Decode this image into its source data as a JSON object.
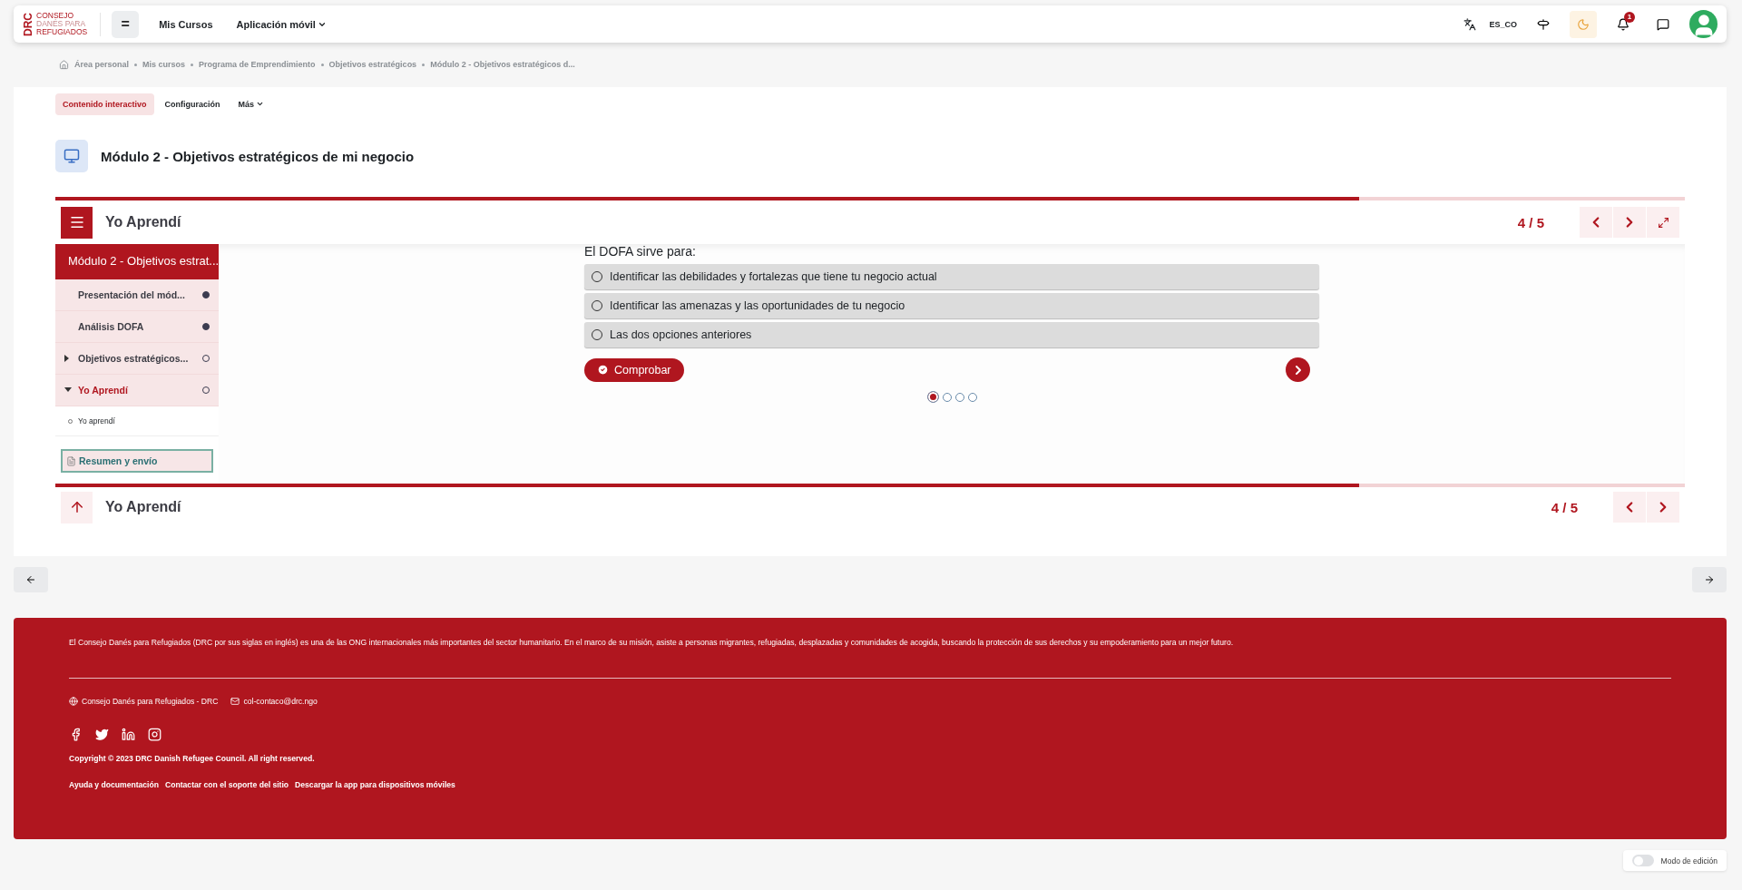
{
  "navbar": {
    "logo_mark": "DRC",
    "logo_lines": [
      "CONSEJO",
      "DANÉS PARA",
      "REFUGIADOS"
    ],
    "menu_button": "=",
    "links": [
      {
        "label": "Mis Cursos",
        "dropdown": false
      },
      {
        "label": "Aplicación móvil",
        "dropdown": true
      }
    ],
    "language": "ES_CO",
    "notifications": "1"
  },
  "breadcrumb": [
    "Área personal",
    "Mis cursos",
    "Programa de Emprendimiento",
    "Objetivos estratégicos",
    "Módulo 2 - Objetivos estratégicos d..."
  ],
  "tabs": [
    {
      "label": "Contenido interactivo",
      "selected": true,
      "dropdown": false
    },
    {
      "label": "Configuración",
      "selected": false,
      "dropdown": false
    },
    {
      "label": "Más",
      "selected": false,
      "dropdown": true
    }
  ],
  "page_title": "Módulo 2 - Objetivos estratégicos de mi negocio",
  "player": {
    "title": "Yo Aprendí",
    "progress": {
      "level": 0.8
    },
    "counter": "4 / 5",
    "sidebar": {
      "heading": "Módulo 2 - Objetivos estrat...",
      "items": [
        {
          "label": "Presentación del mód...",
          "done": true,
          "selected": false
        },
        {
          "label": "Análisis DOFA",
          "done": true,
          "selected": false
        },
        {
          "label": "Objetivos estratégicos...",
          "done": false,
          "selected": false,
          "expanded": false
        },
        {
          "label": "Yo Aprendí",
          "done": false,
          "selected": true,
          "expanded": true,
          "children": [
            {
              "label": "Yo aprendí"
            }
          ]
        }
      ],
      "summary_button": "Resumen y envío"
    },
    "question": "El DOFA sirve para:",
    "options": [
      {
        "label": "Identificar las debilidades y fortalezas que tiene tu negocio actual",
        "selected": false
      },
      {
        "label": "Identificar las amenazas y las oportunidades de tu negocio",
        "selected": false
      },
      {
        "label": "Las dos opciones anteriores",
        "selected": false
      }
    ],
    "check_button": "Comprobar",
    "dots": [
      {
        "selected": true
      },
      {
        "selected": false
      },
      {
        "selected": false
      },
      {
        "selected": false
      }
    ],
    "footer_title": "Yo Aprendí",
    "footer_counter": "4 / 5"
  },
  "footer": {
    "about": "El Consejo Danés para Refugiados (DRC por sus siglas en inglés) es una de las ONG internacionales más importantes del sector humanitario. En el marco de su misión, asiste a personas migrantes, refugiadas, desplazadas y comunidades de acogida, buscando la protección de sus derechos y su empoderamiento para un mejor futuro.",
    "contacts": [
      {
        "kind": "web",
        "label": "Consejo Danés para Refugiados - DRC"
      },
      {
        "kind": "mail",
        "label": "col-contaco@drc.ngo"
      }
    ],
    "social": [
      {
        "kind": "facebook"
      },
      {
        "kind": "twitter"
      },
      {
        "kind": "linkedin"
      },
      {
        "kind": "instagram"
      }
    ],
    "copyright": "Copyright © 2023 DRC Danish Refugee Council. All right reserved.",
    "links": [
      "Ayuda y documentación",
      "Contactar con el soporte del sitio",
      "Descargar la app para dispositivos móviles"
    ]
  },
  "edit_mode": {
    "label": "Modo de edición",
    "on": false
  }
}
